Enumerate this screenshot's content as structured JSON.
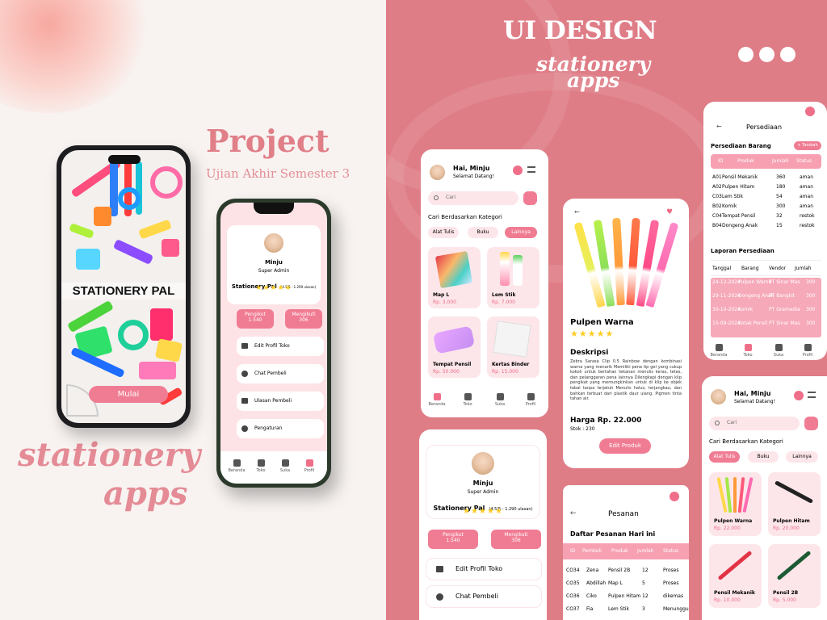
{
  "project": {
    "title": "Project",
    "subtitle": "Ujian Akhir Semester 3",
    "script_line1": "stationery",
    "script_line2": "apps"
  },
  "splash": {
    "title": "STATIONERY PAL",
    "start_button": "Mulai"
  },
  "header": {
    "title": "UI DESIGN",
    "sub_line1": "stationery",
    "sub_line2": "apps"
  },
  "profile": {
    "name": "Minju",
    "role": "Super Admin",
    "store": "Stationery Pal",
    "rating": "(4.5/5 - 1.290 ulasan)",
    "stars": "★★★★★",
    "followers_label": "Pengikut",
    "followers_value": "1.540",
    "following_label": "Mengikuti",
    "following_value": "306",
    "menu": [
      "Edit Profil Toko",
      "Chat Pembeli",
      "Ulasan Pembeli",
      "Pengaturan"
    ]
  },
  "nav": [
    "Beranda",
    "Toko",
    "Suka",
    "Profil"
  ],
  "home": {
    "greeting": "Hai, Minju",
    "welcome": "Selamat Datang!",
    "search_placeholder": "Cari",
    "category_title": "Cari Berdasarkan Kategori",
    "categories": [
      "Alat Tulis",
      "Buku",
      "Lainnya"
    ],
    "products": [
      {
        "name": "Map L",
        "price": "Rp. 3.000"
      },
      {
        "name": "Lem Stik",
        "price": "Rp. 7.000"
      },
      {
        "name": "Tempat Pensil",
        "price": "Rp. 50.000"
      },
      {
        "name": "Kertas Binder",
        "price": "Rp. 15.000"
      }
    ]
  },
  "home2": {
    "products": [
      {
        "name": "Pulpen Warna",
        "price": "Rp. 22.000"
      },
      {
        "name": "Pulpen Hitam",
        "price": "Rp. 20.000"
      },
      {
        "name": "Pensil Mekanik",
        "price": "Rp. 10.000"
      },
      {
        "name": "Pensil 2B",
        "price": "Rp. 5.000"
      }
    ]
  },
  "detail": {
    "name": "Pulpen Warna",
    "stars": "★★★★★",
    "desc_title": "Deskripsi",
    "desc": "Zebra Sarasa Clip 0.5 Rainbow dengan kombinasi warna yang menarik Memiliki pena tip gel yang cukup kokoh untuk bertahan tekanan menulis keras, tetes, dan pelanggaran pena lainnya Dilengkapi dengan klip pengikat yang memungkinkan untuk di klip ke objek tebal tanpa terjatuh Menulis halus, terjangkau, dan bahkan terbuat dari plastik daur ulang. Pigmen tinta tahan air.",
    "price": "Harga Rp. 22.000",
    "stock": "Stok : 230",
    "edit_button": "Edit Produk"
  },
  "inventory": {
    "title": "Persediaan",
    "section": "Persediaan Barang",
    "add_button": "+ Tambah",
    "columns": [
      "ID",
      "Produk",
      "Jumlah",
      "Status"
    ],
    "rows": [
      [
        "A01",
        "Pensil Mekanik",
        "360",
        "aman"
      ],
      [
        "A02",
        "Pulpen Hitam",
        "180",
        "aman"
      ],
      [
        "C03",
        "Lem Stik",
        "54",
        "aman"
      ],
      [
        "B02",
        "Komik",
        "300",
        "aman"
      ],
      [
        "C04",
        "Tempat Pensil",
        "32",
        "restok"
      ],
      [
        "B04",
        "Dongeng Anak",
        "15",
        "restok"
      ]
    ],
    "report_title": "Laporan Persediaan",
    "report_columns": [
      "Tanggal",
      "Barang",
      "Vendor",
      "Jumlah"
    ],
    "report_rows": [
      [
        "24-12-2024",
        "Pulpen Warna",
        "PT Sinar Mas",
        "300"
      ],
      [
        "29-11-2024",
        "Dongeng Anak",
        "PT Bangkit",
        "300"
      ],
      [
        "30-10-2024",
        "Komik",
        "PT Gramedia",
        "300"
      ],
      [
        "15-09-2024",
        "Kotak Pensil",
        "PT Sinar Mas",
        "300"
      ]
    ]
  },
  "orders": {
    "title": "Pesanan",
    "section": "Daftar Pesanan  Hari ini",
    "columns": [
      "ID",
      "Pembeli",
      "Produk",
      "Jumlah",
      "Status"
    ],
    "rows": [
      [
        "CO34",
        "Zena",
        "Pensil 2B",
        "12",
        "Proses"
      ],
      [
        "CO35",
        "Abdillah",
        "Map L",
        "5",
        "Proses"
      ],
      [
        "CO36",
        "Ciko",
        "Pulpen Hitam",
        "12",
        "dikemas"
      ],
      [
        "CO37",
        "Fia",
        "Lem Stik",
        "3",
        "Menunggu"
      ]
    ]
  },
  "colors": {
    "accent": "#f07c93",
    "panel": "#df7d87",
    "soft": "#fde6ea"
  }
}
